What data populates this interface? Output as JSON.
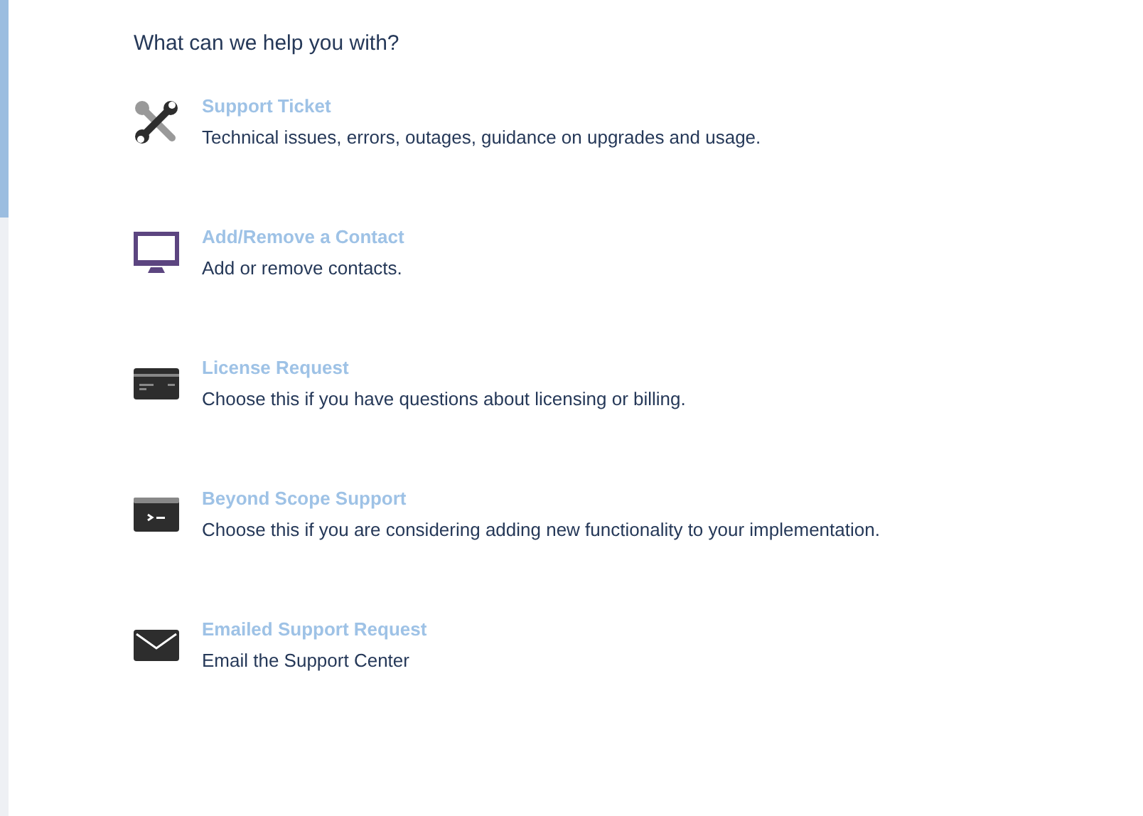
{
  "heading": "What can we help you with?",
  "options": [
    {
      "kind": "tools",
      "title": "Support Ticket",
      "description": "Technical issues, errors, outages, guidance on upgrades and usage."
    },
    {
      "kind": "monitor",
      "title": "Add/Remove a Contact",
      "description": "Add or remove contacts."
    },
    {
      "kind": "card",
      "title": "License Request",
      "description": "Choose this if you have questions about licensing or billing."
    },
    {
      "kind": "terminal",
      "title": "Beyond Scope Support",
      "description": "Choose this if you are considering adding new functionality to your implementation."
    },
    {
      "kind": "mail",
      "title": "Emailed Support Request",
      "description": "Email the Support Center"
    }
  ]
}
